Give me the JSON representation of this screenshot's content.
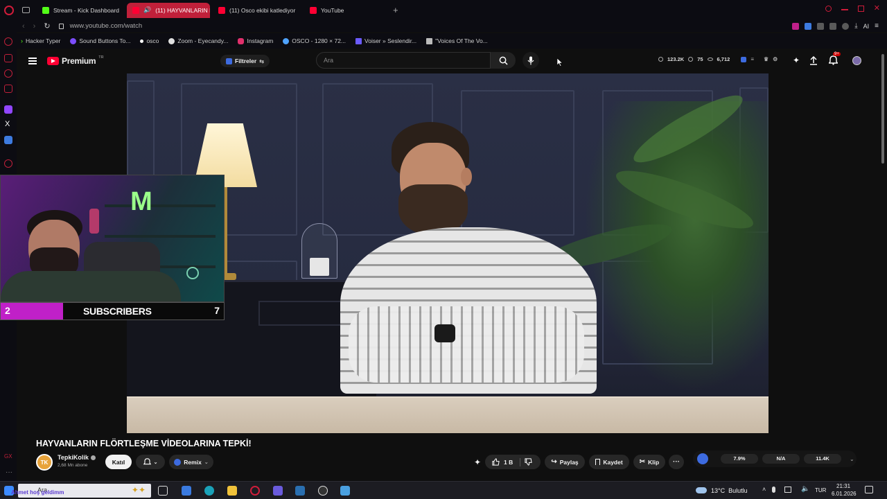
{
  "browser": {
    "tabs": [
      {
        "label": "Stream - Kick Dashboard",
        "active": false,
        "color": "#53fc18"
      },
      {
        "label": "(11) HAYVANLARIN FLÖ",
        "active": true,
        "color": "#ff0033"
      },
      {
        "label": "(11) Osco ekibi katlediyor",
        "active": false,
        "color": "#ff0033"
      },
      {
        "label": "YouTube",
        "active": false,
        "color": "#ff0033"
      }
    ],
    "new_tab": "+",
    "url": "www.youtube.com/watch",
    "ai_label": "AI",
    "bookmarks": [
      {
        "label": "Hacker Typer",
        "icon": "terminal-icon",
        "color": "#53fc18"
      },
      {
        "label": "Sound Buttons To...",
        "icon": "sound-icon",
        "color": "#7c4dff"
      },
      {
        "label": "osco",
        "icon": "dot-icon",
        "color": "#ffffff"
      },
      {
        "label": "Zoom - Eyecandy...",
        "icon": "zoom-icon",
        "color": "#e0e0e0"
      },
      {
        "label": "Instagram",
        "icon": "instagram-icon",
        "color": "#e1306c"
      },
      {
        "label": "OSCO - 1280 × 72...",
        "icon": "globe-icon",
        "color": "#4fa3ff"
      },
      {
        "label": "Voiser » Seslendir...",
        "icon": "voiser-icon",
        "color": "#6b5bff"
      },
      {
        "label": "\"Voices Of The Vo...",
        "icon": "page-icon",
        "color": "#bbbbbb"
      }
    ]
  },
  "youtube": {
    "logo_text": "Premium",
    "logo_region": "TR",
    "filter_label": "Filtreler",
    "search_placeholder": "Ara",
    "stats": {
      "views": "123.2K",
      "likes": "75",
      "watching": "6,712"
    },
    "notifications_badge": "9+"
  },
  "overlay": {
    "left_count": "2",
    "label": "SUBSCRIBERS",
    "right_count": "7"
  },
  "video": {
    "title": "HAYVANLARIN FLÖRTLEŞME VİDEOLARINA TEPKİ!",
    "channel_name": "TepkiKolik",
    "channel_initials": "TK",
    "subscribers": "2,68 Mn abone",
    "join_label": "Katıl",
    "remix_label": "Remix",
    "like_count": "1 B",
    "share_label": "Paylaş",
    "save_label": "Kaydet",
    "clip_label": "Klip",
    "stats_pills": [
      "7.9%",
      "N/A",
      "11.4K"
    ]
  },
  "taskbar": {
    "search_placeholder": "Ara",
    "notice": "Ahmet hoş geldimm",
    "weather": "13°C  Bulutlu",
    "lang": "TUR",
    "time": "21:31",
    "date": "6.01.2026"
  }
}
